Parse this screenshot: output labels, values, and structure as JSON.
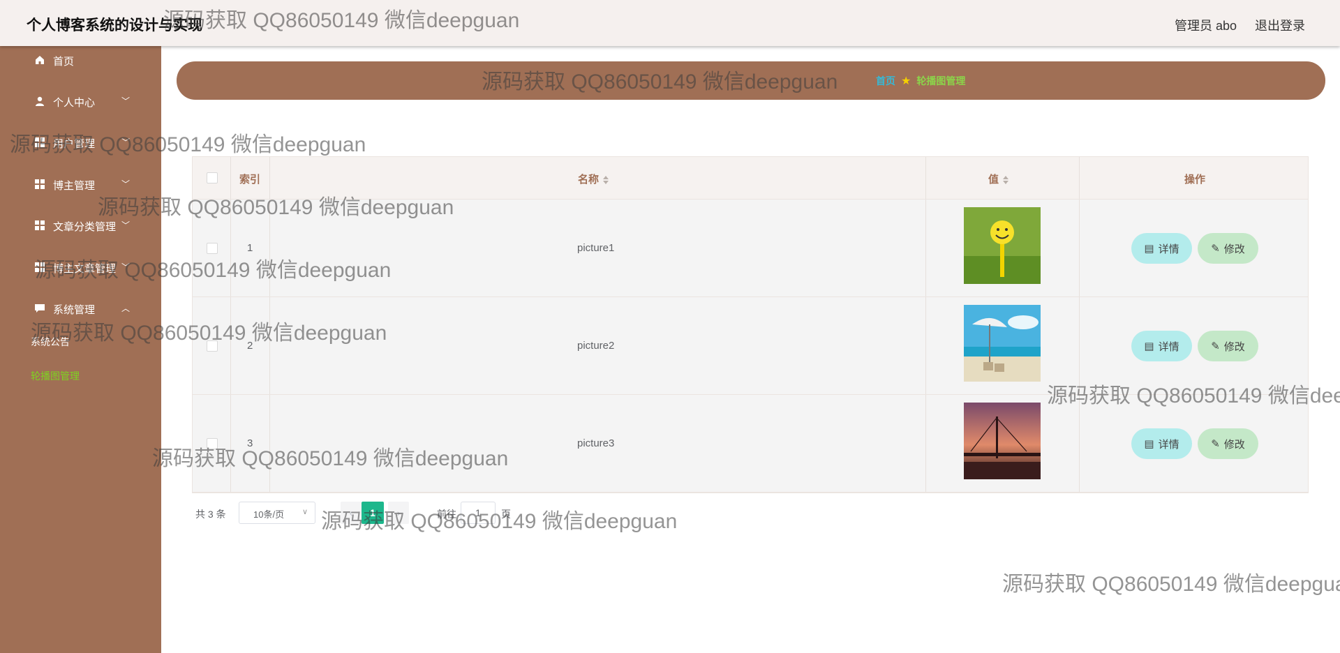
{
  "header": {
    "app_title": "个人博客系统的设计与实现",
    "user_label": "管理员 abo",
    "logout_label": "退出登录"
  },
  "sidebar": {
    "items": [
      {
        "label": "首页",
        "icon": "home-icon"
      },
      {
        "label": "个人中心",
        "icon": "user-icon"
      },
      {
        "label": "用户管理",
        "icon": "grid-icon"
      },
      {
        "label": "博主管理",
        "icon": "grid-icon"
      },
      {
        "label": "文章分类管理",
        "icon": "grid-icon"
      },
      {
        "label": "博主文章管理",
        "icon": "grid-icon"
      },
      {
        "label": "系统管理",
        "icon": "chat-icon"
      }
    ],
    "subitems": [
      {
        "label": "系统公告"
      },
      {
        "label": "轮播图管理"
      }
    ]
  },
  "breadcrumb": {
    "home": "首页",
    "current": "轮播图管理"
  },
  "table": {
    "headers": {
      "index": "索引",
      "name": "名称",
      "value": "值",
      "actions": "操作"
    },
    "rows": [
      {
        "index": "1",
        "name": "picture1",
        "image": "smiley-golf-ball"
      },
      {
        "index": "2",
        "name": "picture2",
        "image": "beach-umbrella"
      },
      {
        "index": "3",
        "name": "picture3",
        "image": "sunset-bridge"
      }
    ],
    "detail_label": "详情",
    "edit_label": "修改"
  },
  "pagination": {
    "total": "共 3 条",
    "page_size": "10条/页",
    "current_page": "1",
    "goto_label": "前往",
    "goto_value": "1",
    "page_unit": "页"
  },
  "watermark": "源码获取 QQ86050149 微信deepguan",
  "colors": {
    "sidebar": "#a06f55",
    "accent_green": "#1db78c",
    "detail_btn": "#b3ecec",
    "edit_btn": "#c4e8c8"
  }
}
